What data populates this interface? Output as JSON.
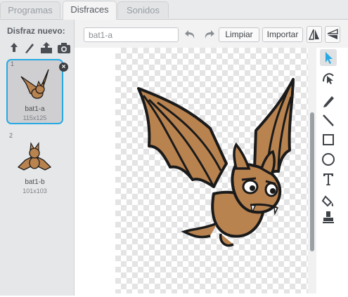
{
  "tabs": [
    "Programas",
    "Disfraces",
    "Sonidos"
  ],
  "costumes_panel": {
    "new_costume_label": "Disfraz nuevo:",
    "new_tools": [
      "paint-from-library-icon",
      "paint-new-icon",
      "upload-icon",
      "camera-icon"
    ],
    "costumes": [
      {
        "number": "1",
        "name": "bat1-a",
        "size": "115x125",
        "selected": true
      },
      {
        "number": "2",
        "name": "bat1-b",
        "size": "101x103",
        "selected": false
      }
    ]
  },
  "editor": {
    "costume_name_value": "bat1-a",
    "clear_label": "Limpiar",
    "import_label": "Importar",
    "toolbar_icons": [
      "undo-icon",
      "redo-icon",
      "flip-horizontal-icon",
      "flip-vertical-icon"
    ]
  },
  "tools": [
    "select-icon",
    "reshape-icon",
    "pencil-icon",
    "line-icon",
    "rectangle-icon",
    "ellipse-icon",
    "text-icon",
    "fill-icon",
    "stamp-icon"
  ],
  "colors": {
    "accent": "#27a9e3",
    "bat_body": "#b98350",
    "outline": "#1a1a1a"
  }
}
